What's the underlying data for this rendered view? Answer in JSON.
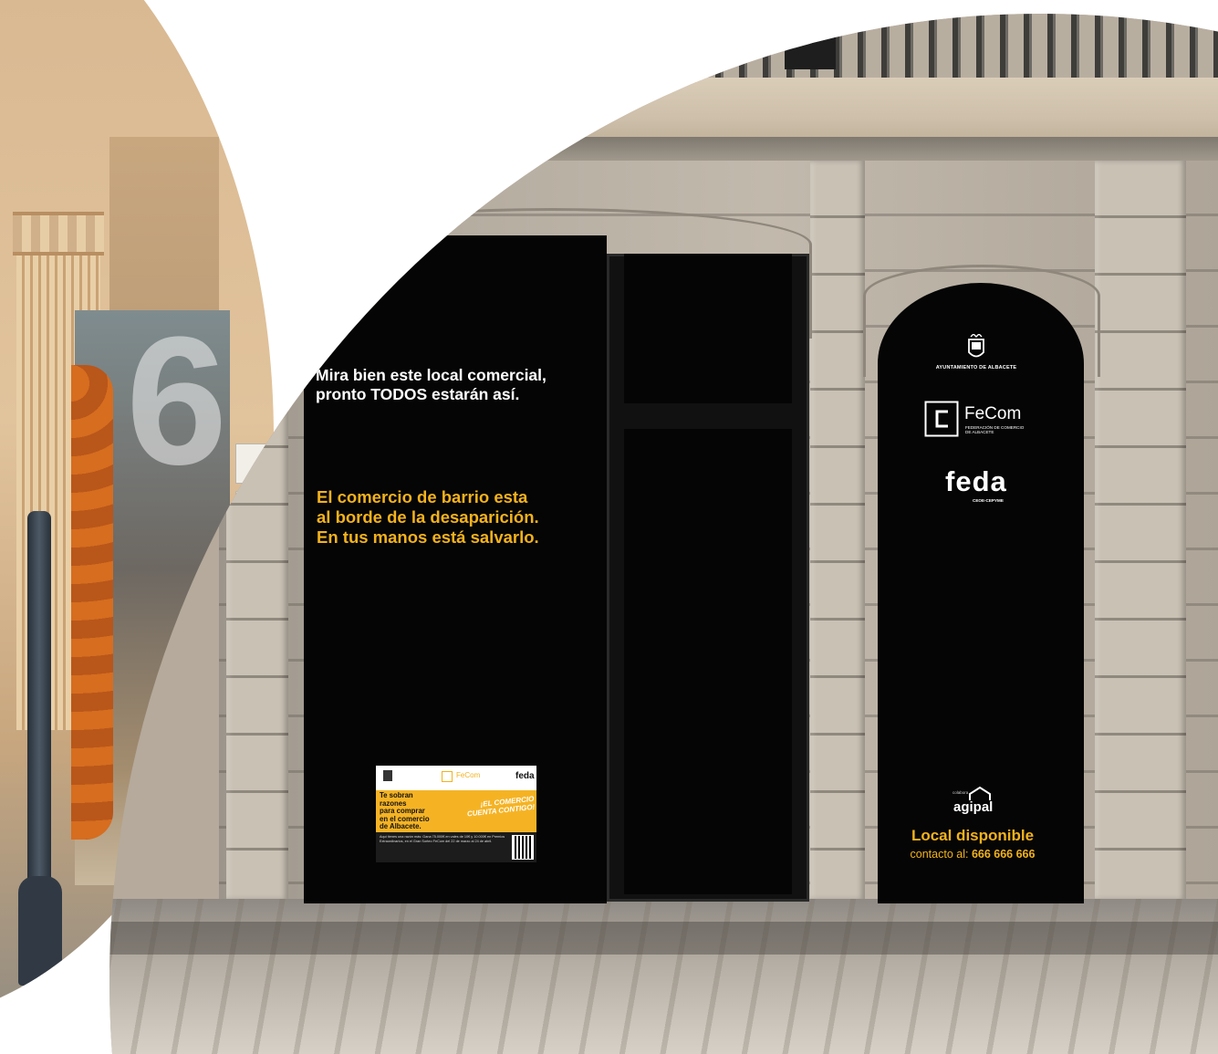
{
  "left_poster": {
    "headline": "Mira bien este local comercial,\npronto TODOS estarán así.",
    "highlight": "El comercio de barrio esta\nal borde de la desaparición.\nEn tus manos está salvarlo."
  },
  "right_poster": {
    "ayuntamiento": "AYUNTAMIENTO DE ALBACETE",
    "fecom_brand": "FeCom",
    "fecom_subtitle": "FEDERACIÓN DE COMERCIO\nDE ALBACETE",
    "feda_brand": "feda",
    "feda_subtitle": "CEOE-CEPYME",
    "agipal_prefix": "colabora",
    "agipal_brand": "agipal",
    "status": "Local disponible",
    "contact_label": "contacto al: ",
    "contact_phone": "666 666 666"
  },
  "flyer": {
    "fecom_brand": "FeCom",
    "feda_brand": "feda",
    "title": "Te sobran razones\npara comprar\nen el comercio\nde Albacete.",
    "slogan": "¡EL COMERCIO\nCUENTA CONTIGO!",
    "body": "Aquí tienes una razón más: Gana 75.000€ en vales de 10€ y 10.000€ en Premios Extraordinarios, en el Gran Sorteo FeCom del 22 de marzo al 24 de abril."
  },
  "left_building": {
    "number": "6"
  },
  "colors": {
    "panel_black": "#050505",
    "accent_yellow": "#f2b21d",
    "flyer_yellow": "#f5b324",
    "alarm_orange": "#e5672d"
  }
}
